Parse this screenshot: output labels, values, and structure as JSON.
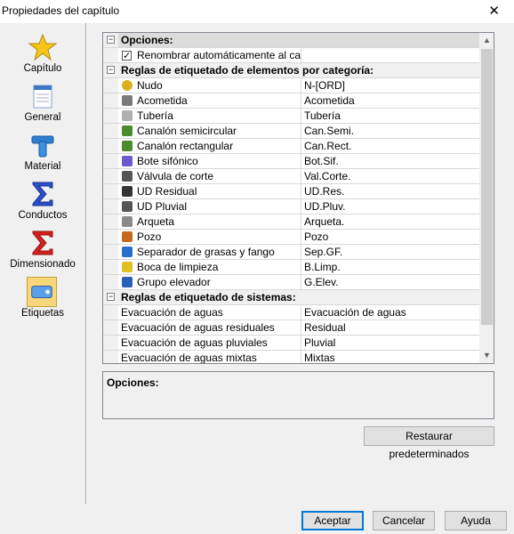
{
  "window": {
    "title": "Propiedades del capítulo",
    "close": "✕"
  },
  "sidebar": {
    "items": [
      {
        "label": "Capítulo",
        "icon": "star-icon"
      },
      {
        "label": "General",
        "icon": "document-icon"
      },
      {
        "label": "Material",
        "icon": "pipe-tee-icon"
      },
      {
        "label": "Conductos",
        "icon": "sigma-blue-icon"
      },
      {
        "label": "Dimensionado",
        "icon": "sigma-red-icon"
      },
      {
        "label": "Etiquetas",
        "icon": "label-tag-icon"
      }
    ],
    "selected": "Etiquetas"
  },
  "grid": {
    "sections": [
      {
        "title": "Opciones:",
        "toggle": "−",
        "rows": [
          {
            "name": "Renombrar automáticamente al calc...",
            "value": "",
            "checkbox": true,
            "checked": true
          }
        ]
      },
      {
        "title": "Reglas de etiquetado de elementos por categoría:",
        "toggle": "−",
        "rows": [
          {
            "name": "Nudo",
            "value": "N-[ORD]",
            "icon": "node-icon",
            "color": "#d9b21b"
          },
          {
            "name": "Acometida",
            "value": "Acometida",
            "icon": "connection-icon",
            "color": "#7a7a7a"
          },
          {
            "name": "Tubería",
            "value": "Tubería",
            "icon": "pipe-icon",
            "color": "#b0b0b0"
          },
          {
            "name": "Canalón semicircular",
            "value": "Can.Semi.",
            "icon": "gutter-semicircular-icon",
            "color": "#4c8a2e"
          },
          {
            "name": "Canalón rectangular",
            "value": "Can.Rect.",
            "icon": "gutter-rectangular-icon",
            "color": "#4c8a2e"
          },
          {
            "name": "Bote sifónico",
            "value": "Bot.Sif.",
            "icon": "siphon-pot-icon",
            "color": "#6a5acd"
          },
          {
            "name": "Válvula de corte",
            "value": "Val.Corte.",
            "icon": "valve-icon",
            "color": "#555555"
          },
          {
            "name": "UD Residual",
            "value": "UD.Res.",
            "icon": "residual-unit-icon",
            "color": "#333333"
          },
          {
            "name": "UD Pluvial",
            "value": "UD.Pluv.",
            "icon": "rain-drain-icon",
            "color": "#555555"
          },
          {
            "name": "Arqueta",
            "value": "Arqueta.",
            "icon": "manhole-box-icon",
            "color": "#8a8a8a"
          },
          {
            "name": "Pozo",
            "value": "Pozo",
            "icon": "well-icon",
            "color": "#c46a1e"
          },
          {
            "name": "Separador de grasas y fango",
            "value": "Sep.GF.",
            "icon": "separator-icon",
            "color": "#2a6fc9"
          },
          {
            "name": "Boca de limpieza",
            "value": "B.Limp.",
            "icon": "cleanout-icon",
            "color": "#e0c020"
          },
          {
            "name": "Grupo elevador",
            "value": "G.Elev.",
            "icon": "pump-icon",
            "color": "#2a5fb9"
          }
        ]
      },
      {
        "title": "Reglas de etiquetado de sistemas:",
        "toggle": "−",
        "rows": [
          {
            "name": "Evacuación de aguas",
            "value": "Evacuación de aguas"
          },
          {
            "name": "Evacuación de aguas residuales",
            "value": "Residual"
          },
          {
            "name": "Evacuación de aguas pluviales",
            "value": "Pluvial"
          },
          {
            "name": "Evacuación de aguas mixtas",
            "value": "Mixtas"
          }
        ]
      }
    ]
  },
  "description": {
    "title": "Opciones:"
  },
  "buttons": {
    "restore": "Restaurar predeterminados",
    "accept": "Aceptar",
    "cancel": "Cancelar",
    "help": "Ayuda"
  }
}
